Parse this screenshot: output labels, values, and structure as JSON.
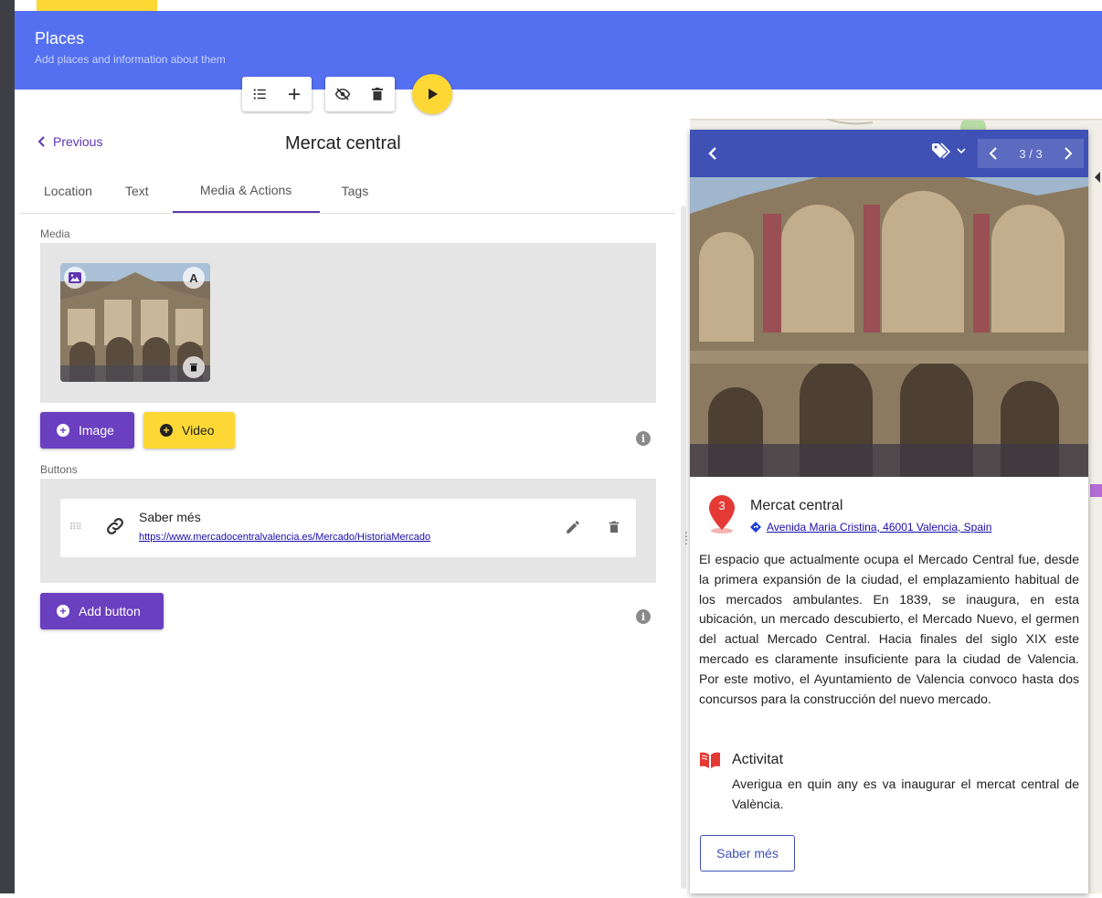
{
  "header": {
    "title": "Places",
    "subtitle": "Add places and information about them"
  },
  "toolbar": {
    "icons": [
      "list-icon",
      "plus-icon",
      "eye-off-icon",
      "trash-icon",
      "play-icon"
    ]
  },
  "editor": {
    "previous_label": "Previous",
    "title": "Mercat central",
    "tabs": [
      {
        "label": "Location",
        "active": false
      },
      {
        "label": "Text",
        "active": false
      },
      {
        "label": "Media & Actions",
        "active": true
      },
      {
        "label": "Tags",
        "active": false
      }
    ],
    "media": {
      "section_label": "Media",
      "thumb_badge": "A",
      "image_button": "Image",
      "video_button": "Video"
    },
    "buttons": {
      "section_label": "Buttons",
      "items": [
        {
          "title": "Saber més",
          "url": "https://www.mercadocentralvalencia.es/Mercado/HistoriaMercado"
        }
      ],
      "add_button": "Add button"
    }
  },
  "preview": {
    "pager": {
      "current": "3",
      "separator": "/",
      "total": "3"
    },
    "pin_number": "3",
    "title": "Mercat central",
    "address": "Avenida Maria Cristina, 46001 Valencia, Spain",
    "description": "El espacio que actualmente ocupa el Mercado Central fue, desde la primera expansión de la ciudad, el emplazamiento habitual de los mercados ambulantes. En 1839, se inaugura, en esta ubicación, un mercado descubierto, el Mercado Nuevo, el germen del actual Mercado Central. Hacia finales del siglo XIX este mercado es claramente insuficiente para la ciudad de Valencia. Por este motivo, el Ayuntamiento de Valencia convoco hasta dos concursos para la construcción del nuevo mercado.",
    "activity": {
      "title": "Activitat",
      "text": "Averigua en quin any es va inaugurar el mercat central de València."
    },
    "cta_button": "Saber més"
  },
  "colors": {
    "header": "#5470f0",
    "accent_purple": "#6a3fc0",
    "accent_yellow": "#fdd835",
    "preview_header": "#3f51b5",
    "pin_red": "#e53935"
  }
}
